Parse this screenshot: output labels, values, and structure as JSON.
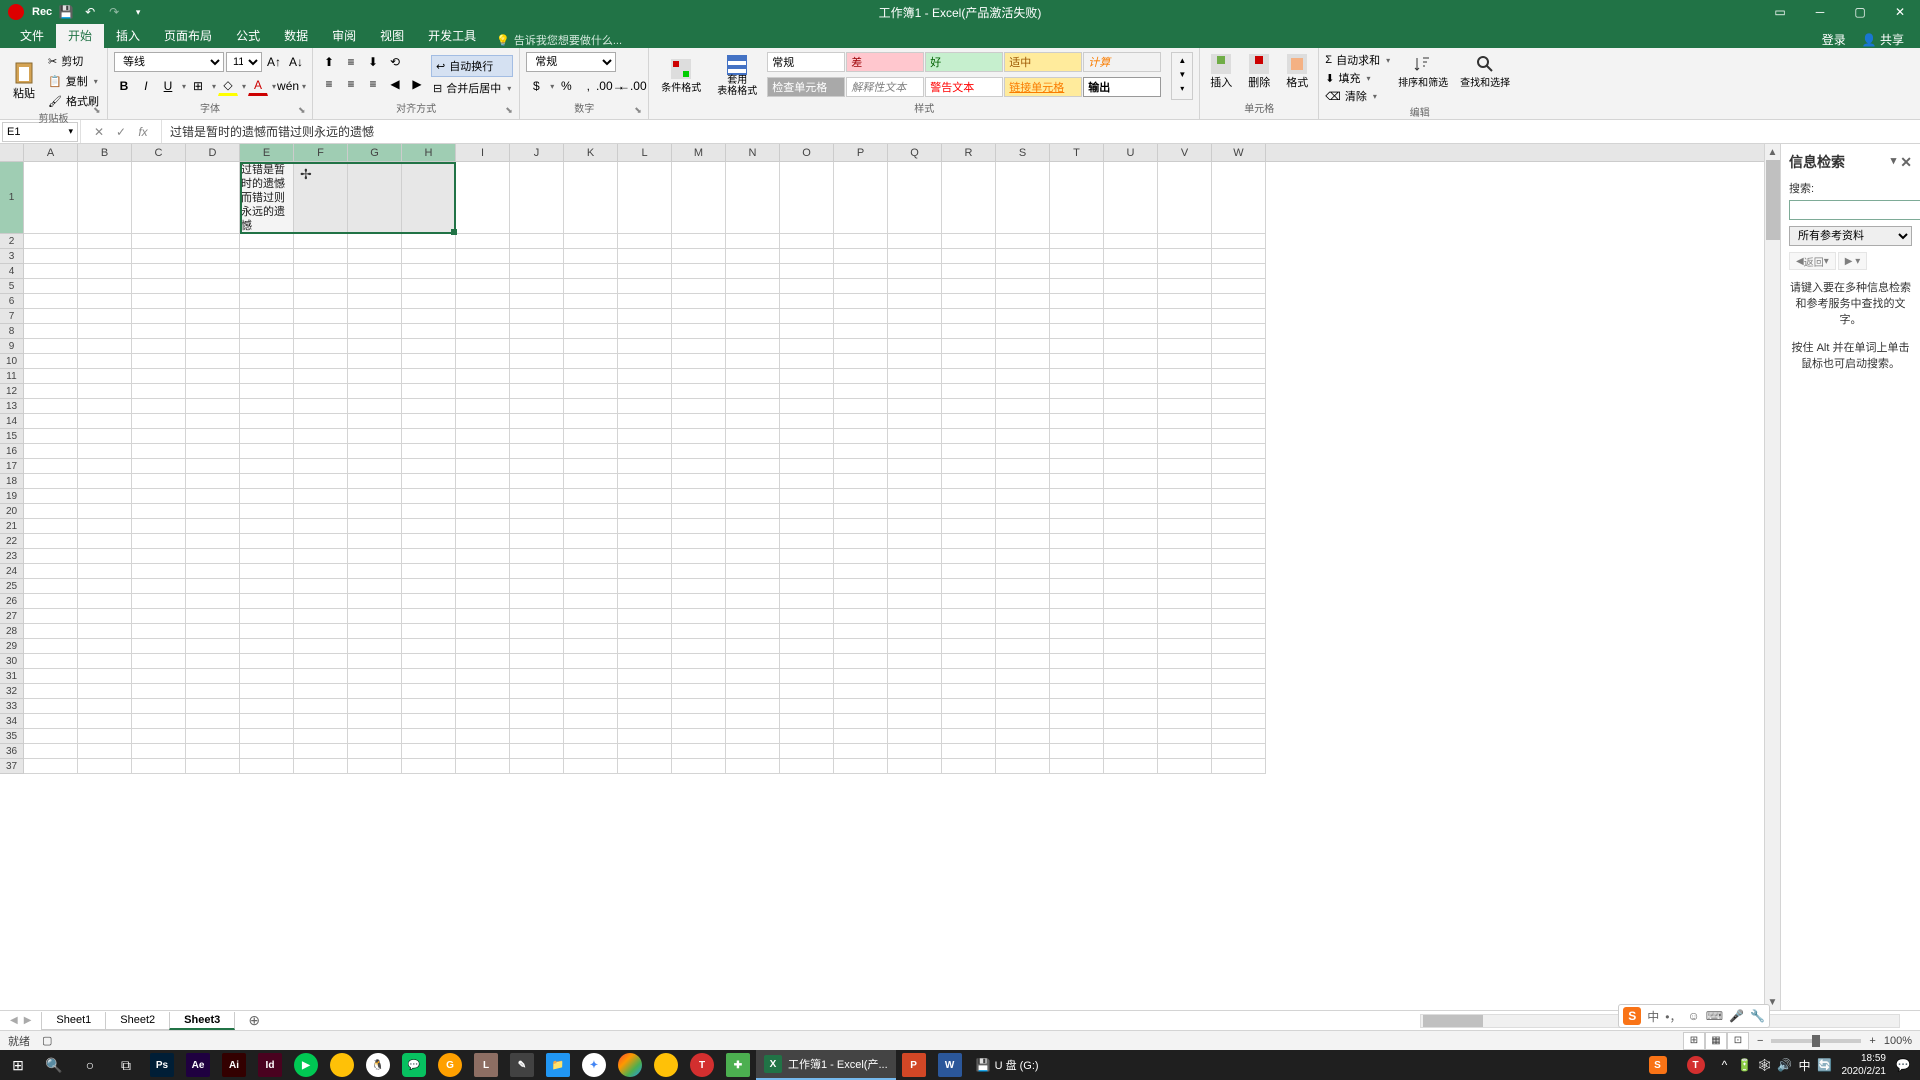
{
  "title": "工作簿1 - Excel(产品激活失败)",
  "qat": {
    "rec": "Rec"
  },
  "tabs": {
    "file": "文件",
    "home": "开始",
    "insert": "插入",
    "layout": "页面布局",
    "formulas": "公式",
    "data": "数据",
    "review": "审阅",
    "view": "视图",
    "dev": "开发工具",
    "tellme": "告诉我您想要做什么..."
  },
  "ribbon_right": {
    "login": "登录",
    "share": "共享"
  },
  "clipboard": {
    "paste": "粘贴",
    "cut": "剪切",
    "copy": "复制",
    "painter": "格式刷",
    "label": "剪贴板"
  },
  "font": {
    "name": "等线",
    "size": "11",
    "label": "字体"
  },
  "alignment": {
    "wrap": "自动换行",
    "merge": "合并后居中",
    "label": "对齐方式"
  },
  "number": {
    "format": "常规",
    "label": "数字"
  },
  "styles": {
    "conditional": "条件格式",
    "table": "套用\n表格格式",
    "normal": "常规",
    "bad": "差",
    "good": "好",
    "neutral": "适中",
    "calc": "计算",
    "check": "检查单元格",
    "explain": "解释性文本",
    "warn": "警告文本",
    "link": "链接单元格",
    "output": "输出",
    "label": "样式"
  },
  "cells": {
    "insert": "插入",
    "delete": "删除",
    "format": "格式",
    "label": "单元格"
  },
  "editing": {
    "sum": "自动求和",
    "fill": "填充",
    "clear": "清除",
    "sort": "排序和筛选",
    "find": "查找和选择",
    "label": "编辑"
  },
  "namebox": "E1",
  "formula": "过错是暂时的遗憾而错过则永远的遗憾",
  "columns": [
    "A",
    "B",
    "C",
    "D",
    "E",
    "F",
    "G",
    "H",
    "I",
    "J",
    "K",
    "L",
    "M",
    "N",
    "O",
    "P",
    "Q",
    "R",
    "S",
    "T",
    "U",
    "V",
    "W"
  ],
  "cell_e1": "过错是暂时的遗憾而错过则永远的遗憾",
  "research": {
    "title": "信息检索",
    "search_label": "搜索:",
    "ref_select": "所有参考资料",
    "back": "返回",
    "hint1": "请键入要在多种信息检索和参考服务中查找的文字。",
    "hint2": "按住 Alt 并在单词上单击鼠标也可启动搜索。"
  },
  "sheets": [
    "Sheet1",
    "Sheet2",
    "Sheet3"
  ],
  "status": {
    "ready": "就绪",
    "zoom": "100%"
  },
  "taskbar": {
    "excel_task": "工作簿1 - Excel(产...",
    "usb": "U 盘 (G:)",
    "time": "18:59",
    "date": "2020/2/21"
  }
}
